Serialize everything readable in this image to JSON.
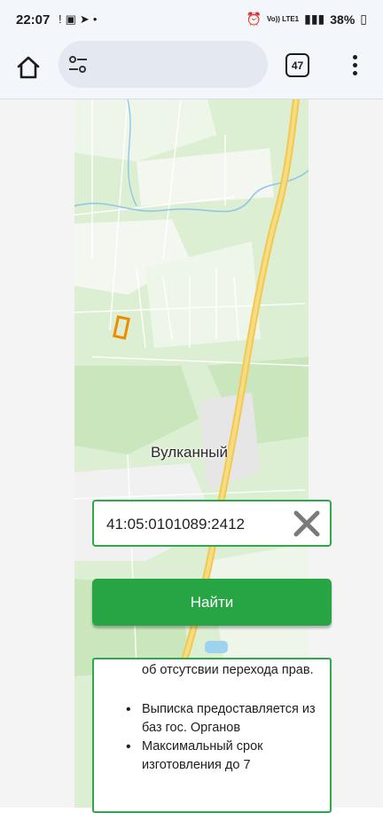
{
  "status_bar": {
    "time": "22:07",
    "network_label": "Vo)) LTE1",
    "battery": "38%"
  },
  "browser": {
    "tabs_count": "47",
    "url_text": ""
  },
  "map": {
    "place_label": "Вулканный"
  },
  "search": {
    "value": "41:05:0101089:2412",
    "find_label": "Найти"
  },
  "info": {
    "continued_text": "об отсутсвии перехода прав.",
    "items": [
      "Выписка предоставляется из баз гос. Органов",
      "Максимальный срок изготовления до 7"
    ]
  },
  "colors": {
    "accent_green": "#27a544",
    "parcel_outline": "#f08a00",
    "road": "#f2c94c"
  }
}
